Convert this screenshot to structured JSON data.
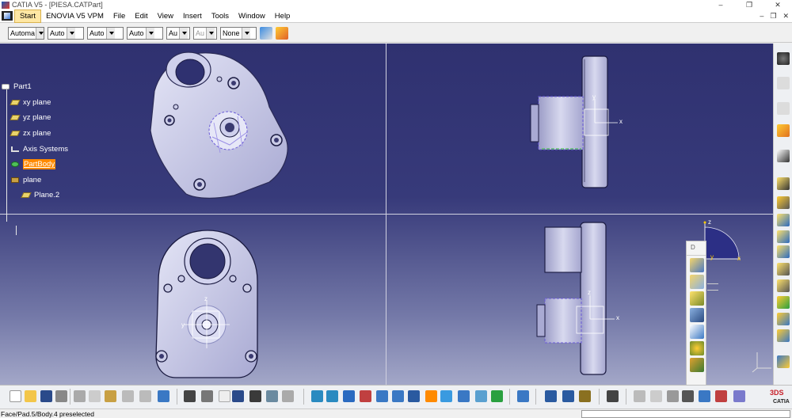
{
  "window": {
    "title": "CATIA V5 - [PIESA.CATPart]",
    "controls": [
      "–",
      "❐",
      "✕"
    ]
  },
  "menu": {
    "items": [
      "Start",
      "ENOVIA V5 VPM",
      "File",
      "Edit",
      "View",
      "Insert",
      "Tools",
      "Window",
      "Help"
    ],
    "mdi_controls": [
      "–",
      "❐",
      "✕"
    ]
  },
  "properties_toolbar": {
    "combos": [
      {
        "value": "Automa",
        "disabled": false
      },
      {
        "value": "Auto",
        "disabled": false
      },
      {
        "value": "Auto",
        "disabled": false
      },
      {
        "value": "Auto",
        "disabled": false
      },
      {
        "value": "Au",
        "disabled": false
      },
      {
        "value": "Au",
        "disabled": true
      },
      {
        "value": "None",
        "disabled": false
      }
    ]
  },
  "tree": {
    "root": "Part1",
    "nodes": [
      "xy plane",
      "yz plane",
      "zx plane",
      "Axis Systems",
      "PartBody",
      "plane",
      "Plane.2"
    ]
  },
  "viewport": {
    "axis_labels": {
      "x": "x",
      "y": "y",
      "z": "z"
    },
    "compass_labels": {
      "x": "x",
      "y": "y",
      "z": "z"
    },
    "context_toolbar_header": "D"
  },
  "colors": {
    "viewport_top": "#2f3170",
    "viewport_bottom": "#a3a7c8",
    "part_fill": "#cacbe6",
    "part_shadow": "#8d8eb8",
    "highlight": "#ff8a00"
  },
  "catia_logo": {
    "mark": "3DS",
    "word": "CATIA"
  },
  "status": {
    "text": "Face/Pad.5/Body.4 preselected"
  }
}
